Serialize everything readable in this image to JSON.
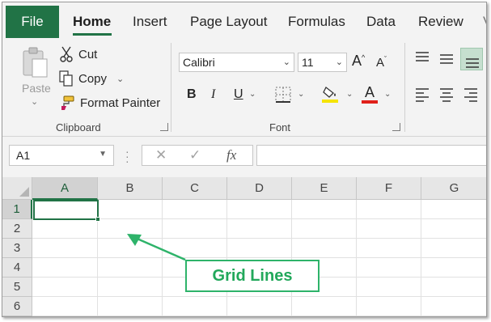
{
  "tabs": {
    "file": "File",
    "items": [
      "Home",
      "Insert",
      "Page Layout",
      "Formulas",
      "Data",
      "Review"
    ],
    "active": "Home"
  },
  "clipboard": {
    "paste": "Paste",
    "cut": "Cut",
    "copy": "Copy",
    "format_painter": "Format Painter",
    "group_label": "Clipboard"
  },
  "font": {
    "family": "Calibri",
    "size": "11",
    "bold": "B",
    "italic": "I",
    "underline": "U",
    "font_color_letter": "A",
    "group_label": "Font",
    "fill_color": "#f5e400",
    "font_color": "#e0201a"
  },
  "formula_bar": {
    "name_box": "A1",
    "cancel_icon": "✕",
    "enter_icon": "✓",
    "fx": "fx"
  },
  "sheet": {
    "columns": [
      "A",
      "B",
      "C",
      "D",
      "E",
      "F",
      "G"
    ],
    "rows": [
      "1",
      "2",
      "3",
      "4",
      "5",
      "6"
    ],
    "active_cell": "A1"
  },
  "callout": {
    "text": "Grid Lines",
    "color": "#22a85b"
  },
  "colors": {
    "accent": "#217346"
  }
}
